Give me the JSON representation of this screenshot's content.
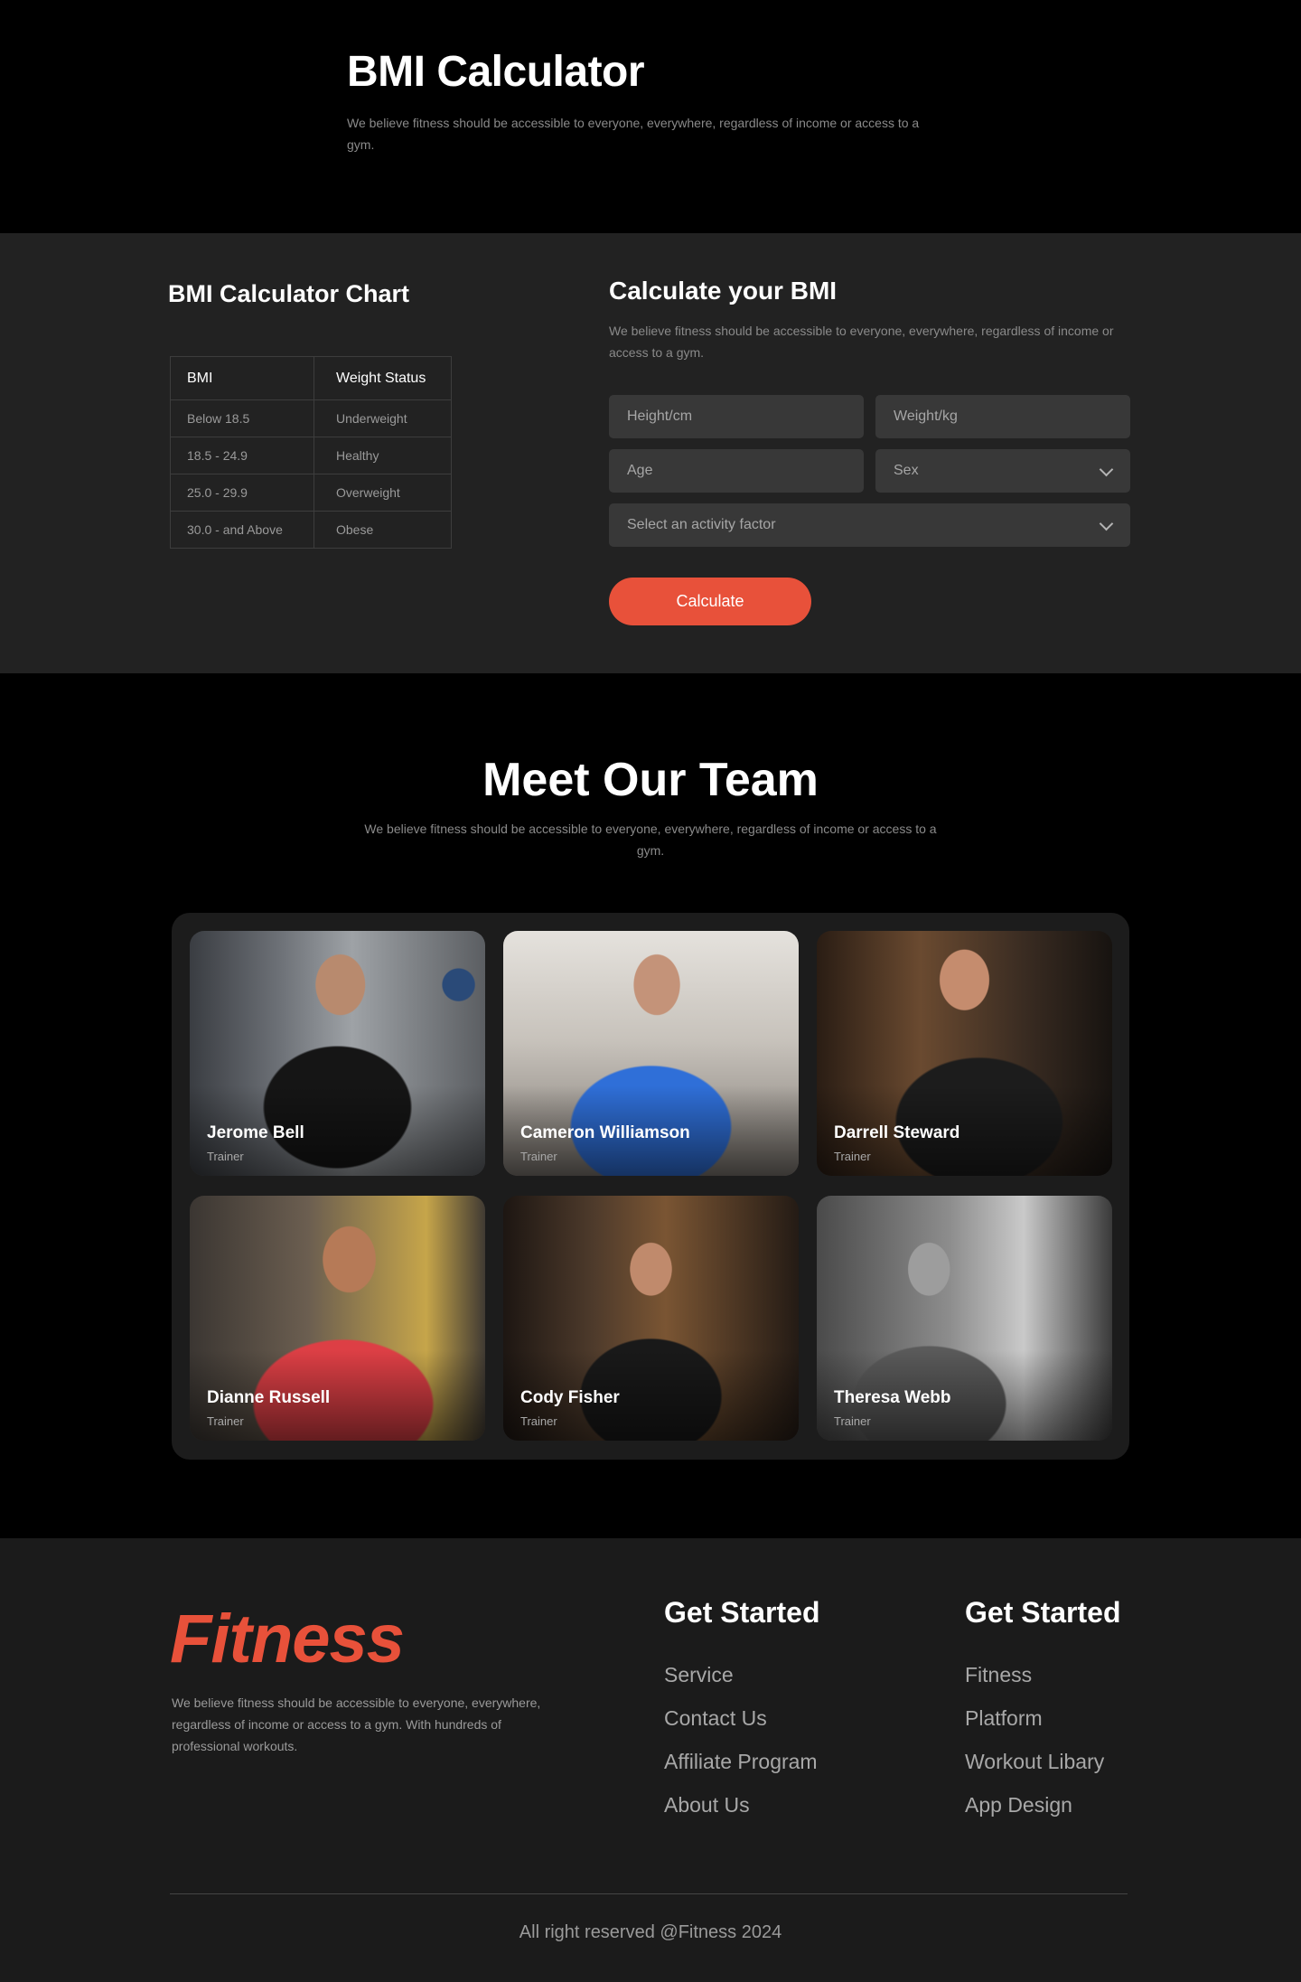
{
  "hero": {
    "title": "BMI Calculator",
    "description": "We believe fitness should be accessible to everyone, everywhere, regardless of income or access to a gym."
  },
  "bmi_chart": {
    "title": "BMI Calculator Chart",
    "headers": [
      "BMI",
      "Weight Status"
    ],
    "rows": [
      [
        "Below 18.5",
        "Underweight"
      ],
      [
        "18.5 - 24.9",
        "Healthy"
      ],
      [
        "25.0 - 29.9",
        "Overweight"
      ],
      [
        "30.0 - and Above",
        "Obese"
      ]
    ]
  },
  "calculator": {
    "title": "Calculate your BMI",
    "description": "We believe fitness should be accessible to everyone, everywhere, regardless of income or access to a gym.",
    "height_placeholder": "Height/cm",
    "weight_placeholder": "Weight/kg",
    "age_placeholder": "Age",
    "sex_label": "Sex",
    "activity_label": "Select an activity factor",
    "button_label": "Calculate",
    "accent_color": "#e8513a"
  },
  "team": {
    "title": "Meet Our Team",
    "description": "We believe fitness should be accessible to everyone, everywhere, regardless of income or access to a gym.",
    "members": [
      {
        "name": "Jerome Bell",
        "role": "Trainer"
      },
      {
        "name": "Cameron Williamson",
        "role": "Trainer"
      },
      {
        "name": "Darrell Steward",
        "role": "Trainer"
      },
      {
        "name": "Dianne Russell",
        "role": "Trainer"
      },
      {
        "name": "Cody Fisher",
        "role": "Trainer"
      },
      {
        "name": "Theresa Webb",
        "role": "Trainer"
      }
    ]
  },
  "footer": {
    "brand": "Fitness",
    "description": "We believe fitness should be accessible to everyone, everywhere, regardless of income or access to a gym. With hundreds of professional workouts.",
    "col1": {
      "title": "Get Started",
      "links": [
        "Service",
        "Contact Us",
        "Affiliate Program",
        "About Us"
      ]
    },
    "col2": {
      "title": "Get Started",
      "links": [
        "Fitness",
        "Platform",
        "Workout Libary",
        "App Design"
      ]
    },
    "copyright": "All right reserved @Fitness 2024"
  }
}
